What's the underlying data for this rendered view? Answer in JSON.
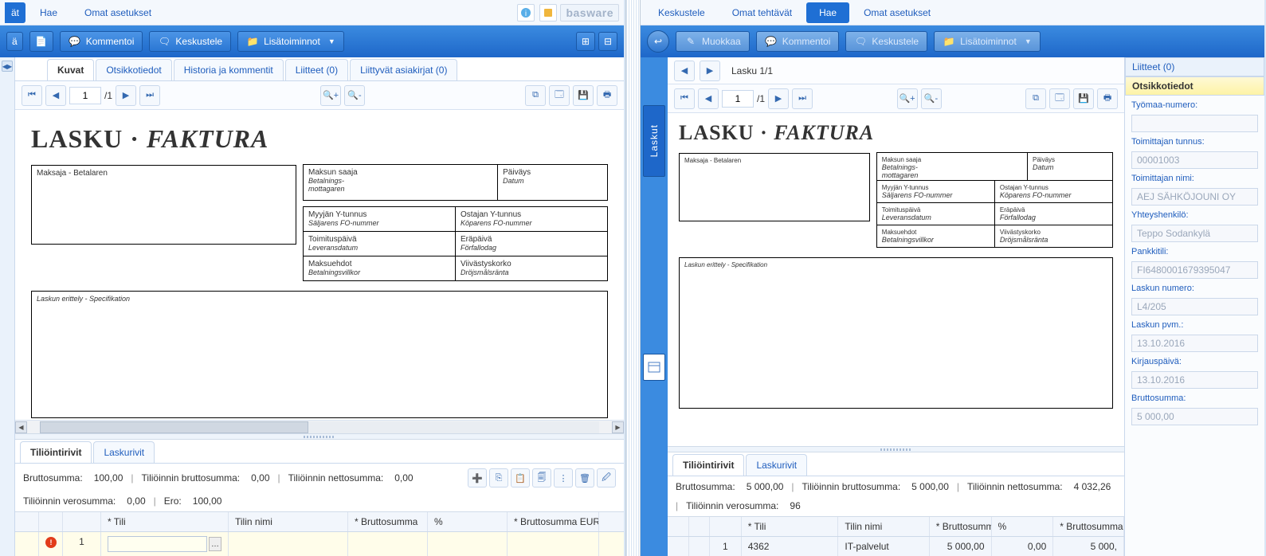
{
  "brand": "basware",
  "left": {
    "menu": {
      "fragment": "ät",
      "items": [
        "Hae",
        "Omat asetukset"
      ]
    },
    "toolbar": {
      "kommentoi": "Kommentoi",
      "keskustele": "Keskustele",
      "lisatoiminnot": "Lisätoiminnot"
    },
    "tabs": {
      "kuvat": "Kuvat",
      "otsikkotiedot": "Otsikkotiedot",
      "historia": "Historia ja kommentit",
      "liitteet": "Liitteet (0)",
      "liittyvat": "Liittyvät asiakirjat (0)"
    },
    "viewer": {
      "page_num": "1",
      "page_total": "/1"
    },
    "doc": {
      "title_a": "LASKU",
      "dot": "·",
      "title_b": "FAKTURA",
      "maksaja": "Maksaja - Betalaren",
      "maksun_saaja1": "Maksun saaja",
      "maksun_saaja2": "Betalnings-",
      "maksun_saaja3": "mottagaren",
      "paivays1": "Päiväys",
      "paivays2": "Datum",
      "myyjan1": "Myyjän Y-tunnus",
      "myyjan2": "Säljarens FO-nummer",
      "ostajan1": "Ostajan Y-tunnus",
      "ostajan2": "Köparens FO-nummer",
      "toimitus1": "Toimituspäivä",
      "toimitus2": "Leveransdatum",
      "erapaiva1": "Eräpäivä",
      "erapaiva2": "Förfallodag",
      "maksuehdot1": "Maksuehdot",
      "maksuehdot2": "Betalningsvillkor",
      "viivastys1": "Viivästyskorko",
      "viivastys2": "Dröjsmålsränta",
      "erittely": "Laskun erittely - Specifikation"
    },
    "lower": {
      "tabs": {
        "tilio": "Tiliöintirivit",
        "lasku": "Laskurivit"
      },
      "summary": {
        "brutto_lbl": "Bruttosumma:",
        "brutto_val": "100,00",
        "tb_lbl": "Tiliöinnin bruttosumma:",
        "tb_val": "0,00",
        "tn_lbl": "Tiliöinnin nettosumma:",
        "tn_val": "0,00",
        "tv_lbl": "Tiliöinnin verosumma:",
        "tv_val": "0,00",
        "ero_lbl": "Ero:",
        "ero_val": "100,00"
      },
      "cols": {
        "tili": "* Tili",
        "tilin_nimi": "Tilin nimi",
        "brutto": "* Bruttosumma",
        "pct": "%",
        "brutto_eur": "* Bruttosumma EUR"
      },
      "row": {
        "n": "1"
      }
    }
  },
  "right": {
    "menu": {
      "items": [
        "Keskustele",
        "Omat tehtävät",
        "Hae",
        "Omat asetukset"
      ],
      "active_index": 2
    },
    "toolbar": {
      "muokkaa": "Muokkaa",
      "kommentoi": "Kommentoi",
      "keskustele": "Keskustele",
      "lisatoiminnot": "Lisätoiminnot"
    },
    "side_vert": "Laskut",
    "nav_title": "Lasku 1/1",
    "viewer": {
      "page_num": "1",
      "page_total": "/1"
    },
    "doc": {
      "title_a": "LASKU",
      "dot": "·",
      "title_b": "FAKTURA",
      "maksaja": "Maksaja - Betalaren",
      "maksun_saaja1": "Maksun saaja",
      "maksun_saaja2": "Betalnings-",
      "maksun_saaja3": "mottagaren",
      "paivays1": "Päiväys",
      "paivays2": "Datum",
      "myyjan1": "Myyjän Y-tunnus",
      "myyjan2": "Säljarens FO-nummer",
      "ostajan1": "Ostajan Y-tunnus",
      "ostajan2": "Köparens FO-nummer",
      "toimitus1": "Toimituspäivä",
      "toimitus2": "Leveransdatum",
      "erapaiva1": "Eräpäivä",
      "erapaiva2": "Förfallodag",
      "maksuehdot1": "Maksuehdot",
      "maksuehdot2": "Betalningsvillkor",
      "viivastys1": "Viivästyskorko",
      "viivastys2": "Dröjsmålsränta",
      "erittely": "Laskun erittely - Specifikation"
    },
    "side_panel": {
      "liitteet": "Liitteet (0)",
      "otsikko": "Otsikkotiedot",
      "fields": [
        {
          "label": "Työmaa-numero:",
          "value": ""
        },
        {
          "label": "Toimittajan tunnus:",
          "value": "00001003"
        },
        {
          "label": "Toimittajan nimi:",
          "value": "AEJ SÄHKÖJOUNI OY"
        },
        {
          "label": "Yhteyshenkilö:",
          "value": "Teppo Sodankylä"
        },
        {
          "label": "Pankkitili:",
          "value": "FI6480001679395047"
        },
        {
          "label": "Laskun numero:",
          "value": "L4/205"
        },
        {
          "label": "Laskun pvm.:",
          "value": "13.10.2016"
        },
        {
          "label": "Kirjauspäivä:",
          "value": "13.10.2016"
        },
        {
          "label": "Bruttosumma:",
          "value": "5 000,00"
        }
      ]
    },
    "lower": {
      "tabs": {
        "tilio": "Tiliöintirivit",
        "lasku": "Laskurivit"
      },
      "summary": {
        "brutto_lbl": "Bruttosumma:",
        "brutto_val": "5 000,00",
        "tb_lbl": "Tiliöinnin bruttosumma:",
        "tb_val": "5 000,00",
        "tn_lbl": "Tiliöinnin nettosumma:",
        "tn_val": "4 032,26",
        "tv_lbl": "Tiliöinnin verosumma:",
        "tv_val_frag": "96"
      },
      "cols": {
        "tili": "* Tili",
        "tilin_nimi": "Tilin nimi",
        "brutto": "* Bruttosumma",
        "pct": "%",
        "brutto_eur": "* Bruttosumma EU"
      },
      "row": {
        "n": "1",
        "tili": "4362",
        "nimi": "IT-palvelut",
        "brutto": "5 000,00",
        "pct": "0,00",
        "brutto_eur": "5 000,"
      }
    }
  }
}
